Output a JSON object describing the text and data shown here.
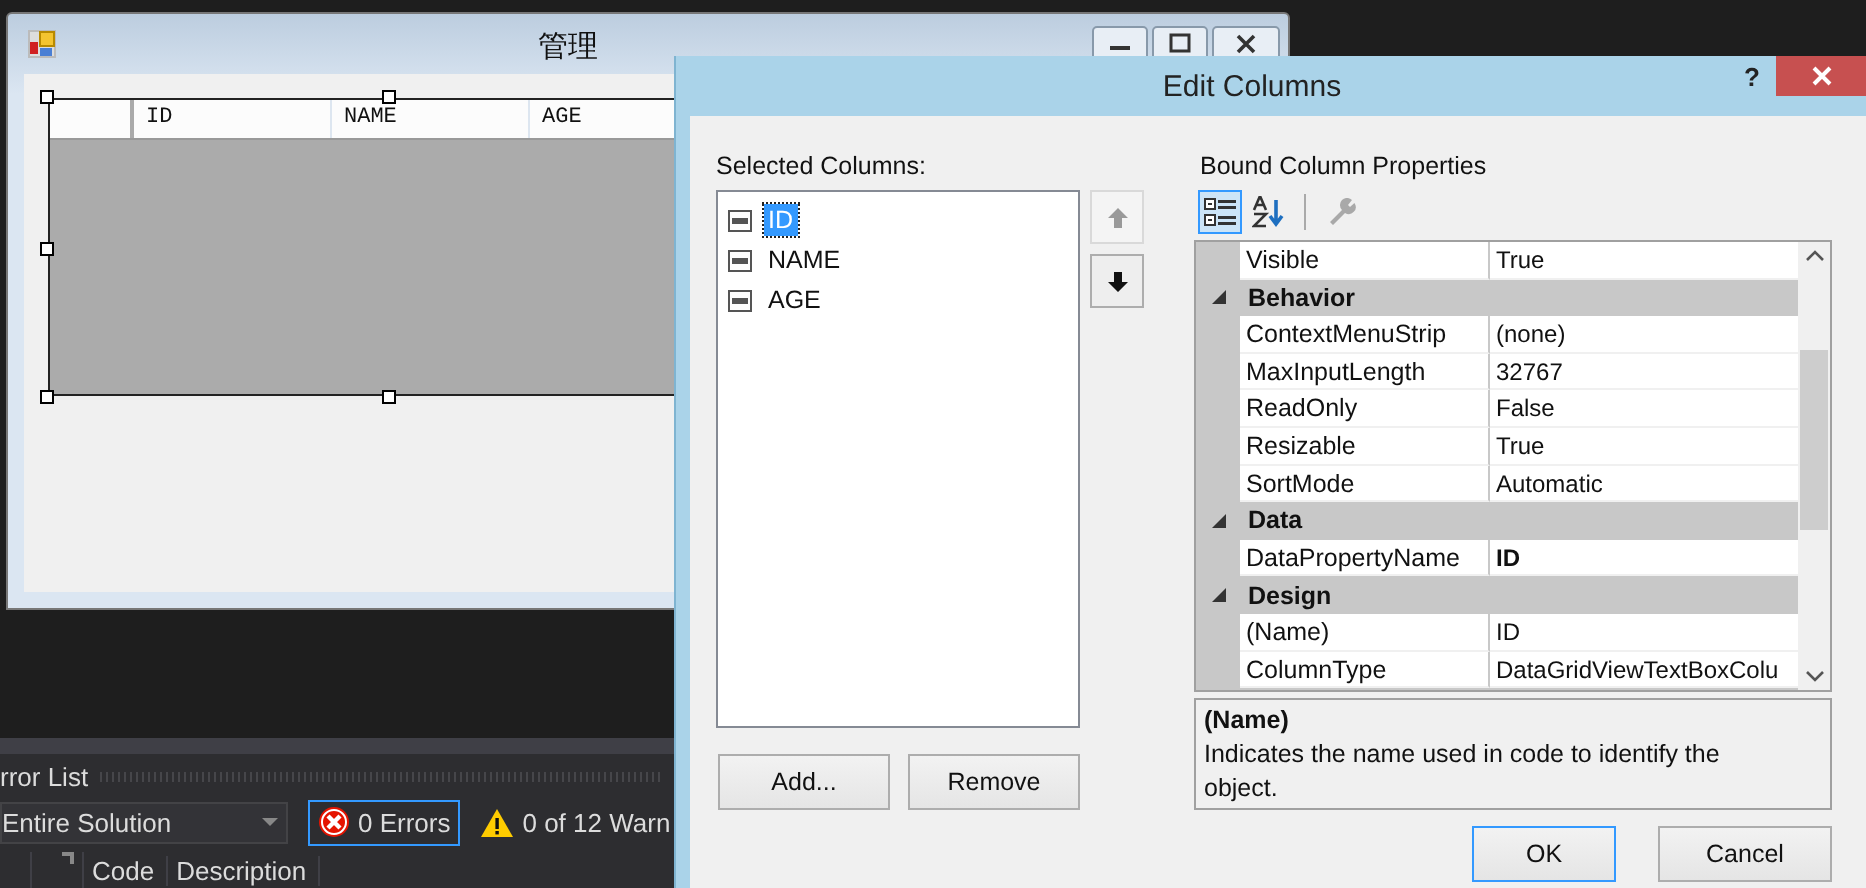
{
  "form": {
    "title": "管理",
    "grid": {
      "columns": [
        "ID",
        "NAME",
        "AGE"
      ]
    }
  },
  "error_list": {
    "title": "rror List",
    "scope": "Entire Solution",
    "filters": [
      {
        "kind": "errors",
        "label": "0 Errors",
        "selected": true
      },
      {
        "kind": "warnings",
        "label": "0 of 12 Warn",
        "selected": false
      }
    ],
    "columns": [
      "Code",
      "Description"
    ]
  },
  "dialog": {
    "title": "Edit Columns",
    "help": "?",
    "selected_columns": {
      "label": "Selected Columns:",
      "items": [
        {
          "name": "ID",
          "selected": true
        },
        {
          "name": "NAME",
          "selected": false
        },
        {
          "name": "AGE",
          "selected": false
        }
      ]
    },
    "add_button": "Add...",
    "remove_button": "Remove",
    "properties": {
      "label": "Bound Column Properties",
      "toolbar": [
        {
          "kind": "categorized",
          "selected": true,
          "disabled": false
        },
        {
          "kind": "alphabetical",
          "selected": false,
          "disabled": false
        },
        {
          "kind": "property_pages",
          "selected": false,
          "disabled": true
        }
      ],
      "rows": [
        {
          "kind": "property",
          "name": "Visible",
          "value": "True",
          "modified": false
        },
        {
          "kind": "category",
          "name": "Behavior",
          "expanded": true
        },
        {
          "kind": "property",
          "name": "ContextMenuStrip",
          "value": "(none)",
          "modified": false
        },
        {
          "kind": "property",
          "name": "MaxInputLength",
          "value": "32767",
          "modified": false
        },
        {
          "kind": "property",
          "name": "ReadOnly",
          "value": "False",
          "modified": false
        },
        {
          "kind": "property",
          "name": "Resizable",
          "value": "True",
          "modified": false
        },
        {
          "kind": "property",
          "name": "SortMode",
          "value": "Automatic",
          "modified": false
        },
        {
          "kind": "category",
          "name": "Data",
          "expanded": true
        },
        {
          "kind": "property",
          "name": "DataPropertyName",
          "value": "ID",
          "modified": true
        },
        {
          "kind": "category",
          "name": "Design",
          "expanded": true
        },
        {
          "kind": "property",
          "name": "(Name)",
          "value": "ID",
          "modified": false
        },
        {
          "kind": "property",
          "name": "ColumnType",
          "value": "DataGridViewTextBoxColu",
          "modified": false
        }
      ],
      "description": {
        "title": "(Name)",
        "text": "Indicates the name used in code to identify the object."
      }
    },
    "ok_button": "OK",
    "cancel_button": "Cancel"
  }
}
